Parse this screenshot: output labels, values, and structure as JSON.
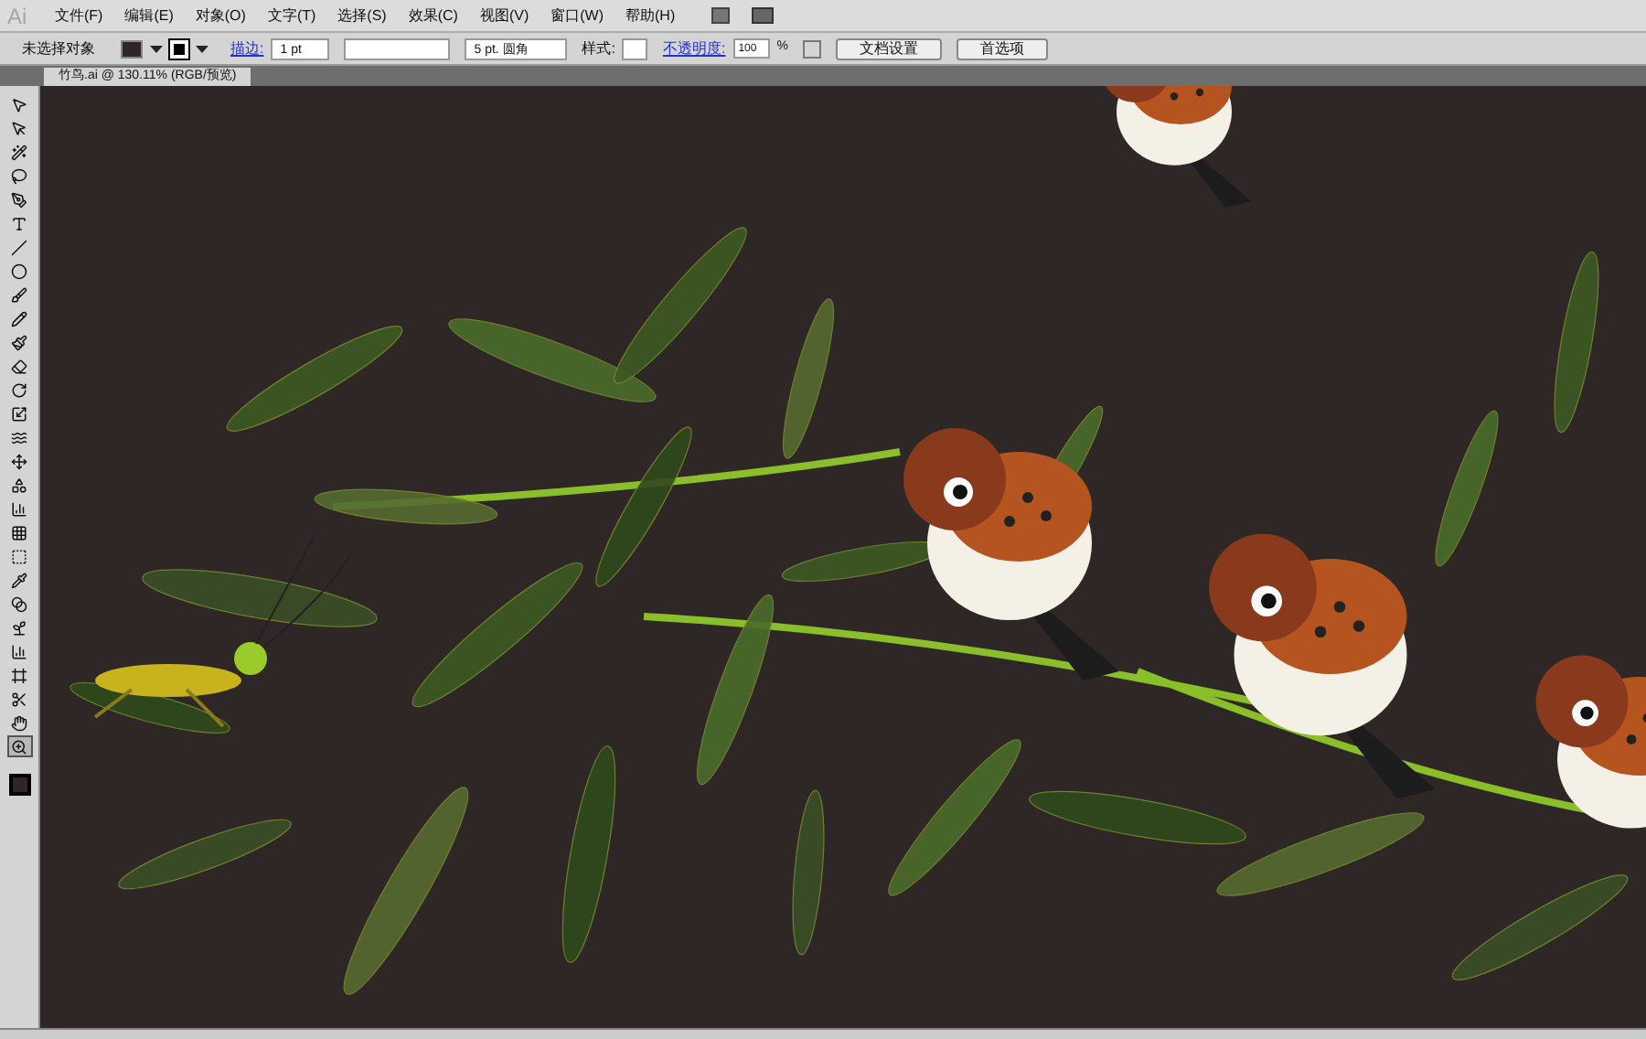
{
  "menu_bar": {
    "logo": "Ai",
    "items": [
      "文件(F)",
      "编辑(E)",
      "对象(O)",
      "文字(T)",
      "选择(S)",
      "效果(C)",
      "视图(V)",
      "窗口(W)",
      "帮助(H)"
    ]
  },
  "control_bar": {
    "selection_label": "未选择对象",
    "stroke_label": "描边:",
    "stroke_weight": "1 pt",
    "brush": "5 pt. 圆角",
    "style_label": "样式:",
    "opacity_label": "不透明度:",
    "opacity_value": "100",
    "percent": "%",
    "buttons": [
      "文档设置",
      "首选项"
    ]
  },
  "document_tab": {
    "title": "竹鸟.ai @ 130.11% (RGB/预览)",
    "selected": true
  },
  "tools": [
    {
      "kind": "select",
      "selected": false
    },
    {
      "kind": "direct",
      "selected": false
    },
    {
      "kind": "wand",
      "selected": false
    },
    {
      "kind": "lasso",
      "selected": false
    },
    {
      "kind": "pen",
      "selected": false
    },
    {
      "kind": "type",
      "selected": false
    },
    {
      "kind": "line",
      "selected": false
    },
    {
      "kind": "ellipse",
      "selected": false
    },
    {
      "kind": "brush",
      "selected": false
    },
    {
      "kind": "pencil",
      "selected": false
    },
    {
      "kind": "blob",
      "selected": false
    },
    {
      "kind": "eraser",
      "selected": false
    },
    {
      "kind": "rotate",
      "selected": false
    },
    {
      "kind": "scale",
      "selected": false
    },
    {
      "kind": "warp",
      "selected": false
    },
    {
      "kind": "transform",
      "selected": false
    },
    {
      "kind": "shape",
      "selected": false
    },
    {
      "kind": "graph",
      "selected": false
    },
    {
      "kind": "mesh",
      "selected": false
    },
    {
      "kind": "gradient",
      "selected": false
    },
    {
      "kind": "eyedropper",
      "selected": false
    },
    {
      "kind": "blend",
      "selected": false
    },
    {
      "kind": "symbol",
      "selected": false
    },
    {
      "kind": "chart",
      "selected": false
    },
    {
      "kind": "artboard",
      "selected": false
    },
    {
      "kind": "slice",
      "selected": false
    },
    {
      "kind": "hand",
      "selected": false
    },
    {
      "kind": "zoom",
      "selected": true
    }
  ]
}
